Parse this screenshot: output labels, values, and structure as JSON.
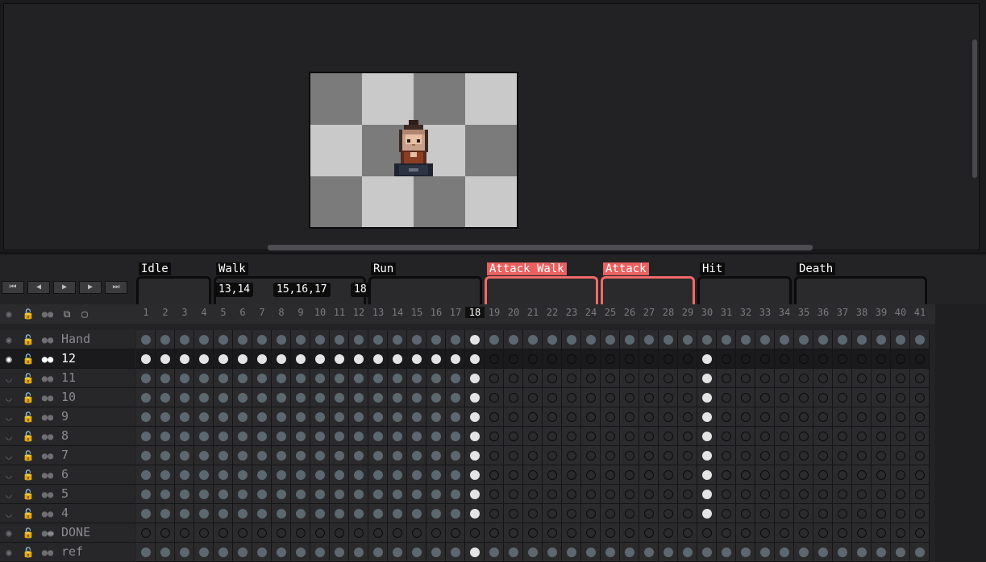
{
  "tags": [
    {
      "label": "Idle",
      "color": "#0c0c0c",
      "from": 1,
      "to": 4
    },
    {
      "label": "Walk",
      "color": "#0c0c0c",
      "from": 5,
      "to": 12
    },
    {
      "label": "Run",
      "color": "#0c0c0c",
      "from": 13,
      "to": 18
    },
    {
      "label": "Attack Walk",
      "color": "#e8605f",
      "from": 19,
      "to": 24
    },
    {
      "label": "Attack",
      "color": "#e8605f",
      "from": 25,
      "to": 29
    },
    {
      "label": "Hit",
      "color": "#0c0c0c",
      "from": 30,
      "to": 34
    },
    {
      "label": "Death",
      "color": "#0c0c0c",
      "from": 35,
      "to": 41
    }
  ],
  "segment_labels": [
    {
      "label": "13,14",
      "from": 5,
      "to": 6
    },
    {
      "label": "15,16,17",
      "from": 8,
      "to": 10
    },
    {
      "label": "18",
      "from": 12,
      "to": 12
    }
  ],
  "playback_buttons": [
    {
      "name": "first-frame-button",
      "icon": "skip-start-icon",
      "glyph": "⏮"
    },
    {
      "name": "prev-frame-button",
      "icon": "step-back-icon",
      "glyph": "◀"
    },
    {
      "name": "play-button",
      "icon": "play-icon",
      "glyph": "▶"
    },
    {
      "name": "next-frame-button",
      "icon": "step-forward-icon",
      "glyph": "▶"
    },
    {
      "name": "last-frame-button",
      "icon": "skip-end-icon",
      "glyph": "⏭"
    }
  ],
  "frame_count": 41,
  "current_frame": 18,
  "layers": [
    {
      "name": "Hand",
      "visible": true,
      "active": false,
      "group": false,
      "pattern": "all-full",
      "white_frames": [
        18
      ]
    },
    {
      "name": "12",
      "visible": true,
      "active": true,
      "group": false,
      "pattern": "white-to-18",
      "white_frames": [
        30
      ]
    },
    {
      "name": "11",
      "visible": false,
      "active": false,
      "group": false,
      "pattern": "full-to-18",
      "white_frames": [
        18,
        30
      ]
    },
    {
      "name": "10",
      "visible": false,
      "active": false,
      "group": false,
      "pattern": "full-to-18",
      "white_frames": [
        18,
        30
      ]
    },
    {
      "name": "9",
      "visible": false,
      "active": false,
      "group": false,
      "pattern": "full-to-18",
      "white_frames": [
        18,
        30
      ]
    },
    {
      "name": "8",
      "visible": false,
      "active": false,
      "group": false,
      "pattern": "full-to-18",
      "white_frames": [
        18,
        30
      ]
    },
    {
      "name": "7",
      "visible": false,
      "active": false,
      "group": false,
      "pattern": "full-to-18",
      "white_frames": [
        18,
        30
      ]
    },
    {
      "name": "6",
      "visible": false,
      "active": false,
      "group": false,
      "pattern": "full-to-18",
      "white_frames": [
        18,
        30
      ]
    },
    {
      "name": "5",
      "visible": false,
      "active": false,
      "group": false,
      "pattern": "full-to-18",
      "white_frames": [
        18,
        30
      ]
    },
    {
      "name": "4",
      "visible": false,
      "active": false,
      "group": false,
      "pattern": "full-to-18",
      "white_frames": [
        18,
        30
      ]
    },
    {
      "name": "DONE",
      "visible": true,
      "active": false,
      "group": true,
      "pattern": "all-empty",
      "white_frames": []
    },
    {
      "name": "ref",
      "visible": true,
      "active": false,
      "group": false,
      "pattern": "all-full",
      "white_frames": [
        18
      ]
    }
  ],
  "colors": {
    "accent_red": "#e8605f",
    "cel_full": "#5c6870",
    "cel_current": "#e4e4e4"
  }
}
